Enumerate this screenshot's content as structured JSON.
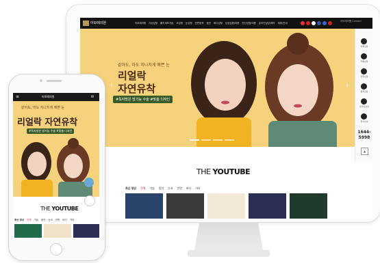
{
  "desktop": {
    "nav": {
      "logo": "아모레의원",
      "menu": [
        "아모레의원",
        "가슴성형",
        "줄기세포가슴",
        "코성형",
        "눈성형",
        "안면윤곽",
        "동안",
        "바디성형",
        "남성성형/미용",
        "전신성형/미용",
        "온라인상담/예약",
        "제휴/안내"
      ],
      "right_text": "아모레의원 Contact"
    },
    "hero": {
      "subtitle": "같아도, 마도 지나치게 예쁜 눈",
      "title_line1": "리얼락",
      "title_line2": "자연유착",
      "tag": "#독자방은 방기능 수술 #맞춤 디자인"
    },
    "side": {
      "items": [
        "카톡상담",
        "카톡상담",
        "전화상담",
        "문자상담",
        "온라인상담",
        "위치안내"
      ],
      "phone": "1644-5998"
    },
    "youtube": {
      "title_prefix": "THE",
      "title": "YOUTUBE",
      "tabs_label": "최신 영상",
      "tabs": [
        "전체",
        "가슴",
        "동안",
        "눈코",
        "안면",
        "바디",
        "기타"
      ]
    }
  },
  "mobile": {
    "nav": {
      "logo": "아모레의원"
    },
    "hero": {
      "subtitle": "같아도, 마도 지나치게 예쁜 눈",
      "title_a": "리얼락",
      "title_b": "자연유착",
      "tag": "#독자방은 방기능 수술 #맞춤 디자인"
    },
    "youtube": {
      "title_prefix": "THE",
      "title": "YOUTUBE",
      "tabs_label": "최신 영상",
      "tabs": [
        "전체",
        "가슴",
        "동안",
        "눈코",
        "안면",
        "바디",
        "기타"
      ]
    }
  }
}
